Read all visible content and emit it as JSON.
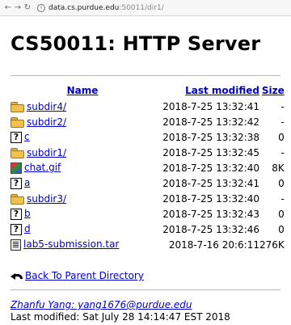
{
  "browser": {
    "url_host": "data.cs.purdue.edu",
    "url_path": ":50011/dir1/"
  },
  "page": {
    "title": "CS50011: HTTP Server"
  },
  "table": {
    "headers": {
      "name": "Name",
      "modified": "Last modified",
      "size": "Size"
    },
    "rows": [
      {
        "icon": "folder-icon",
        "name": "subdir4/",
        "modified": "2018-7-25 13:32:41",
        "size": "-"
      },
      {
        "icon": "folder-icon",
        "name": "subdir2/",
        "modified": "2018-7-25 13:32:42",
        "size": "-"
      },
      {
        "icon": "unknown-file-icon",
        "name": "c",
        "modified": "2018-7-25 13:32:38",
        "size": "0"
      },
      {
        "icon": "folder-icon",
        "name": "subdir1/",
        "modified": "2018-7-25 13:32:45",
        "size": "-"
      },
      {
        "icon": "image-file-icon",
        "name": "chat.gif",
        "modified": "2018-7-25 13:32:40",
        "size": "8K"
      },
      {
        "icon": "unknown-file-icon",
        "name": "a",
        "modified": "2018-7-25 13:32:41",
        "size": "0"
      },
      {
        "icon": "folder-icon",
        "name": "subdir3/",
        "modified": "2018-7-25 13:32:40",
        "size": "-"
      },
      {
        "icon": "unknown-file-icon",
        "name": "b",
        "modified": "2018-7-25 13:32:43",
        "size": "0"
      },
      {
        "icon": "unknown-file-icon",
        "name": "d",
        "modified": "2018-7-25 13:32:46",
        "size": "0"
      },
      {
        "icon": "tar-archive-icon",
        "name": "lab5-submission.tar",
        "modified": "2018-7-16 20:6:11",
        "size": "276K"
      }
    ]
  },
  "back_link": {
    "icon": "back-arrow-icon",
    "label": "Back To Parent Directory"
  },
  "footer": {
    "author_link": "Zhanfu Yang: yang1676@purdue.edu",
    "last_modified": "Last modified: Sat July 28 14:14:47 EST 2018"
  }
}
